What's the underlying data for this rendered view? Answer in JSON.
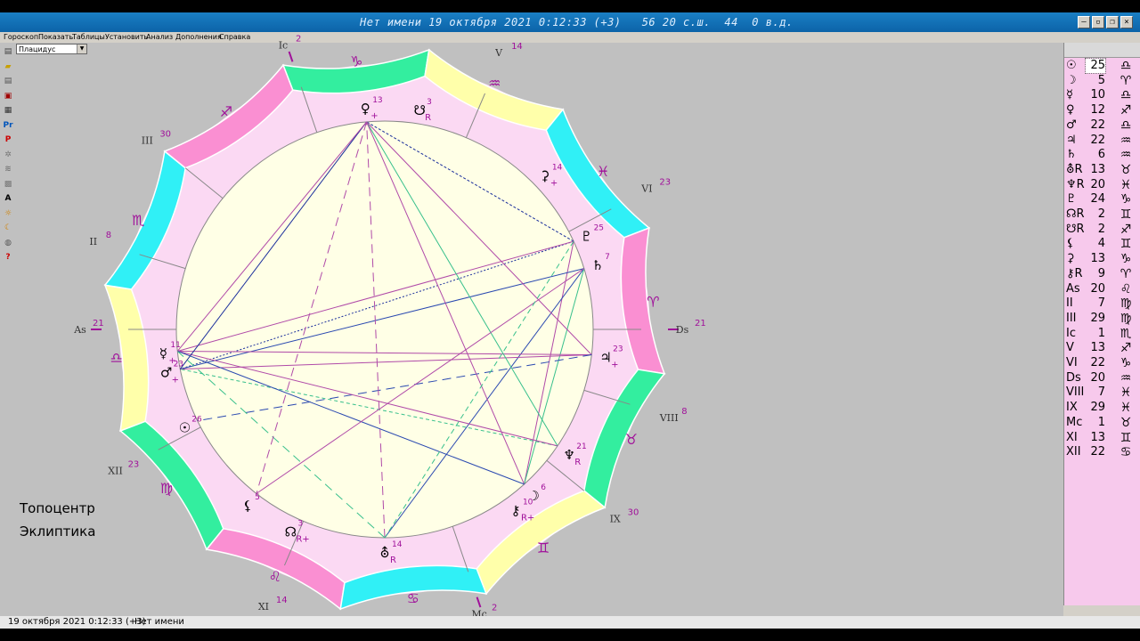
{
  "window": {
    "title": "Нет имени 19 октября 2021 0:12:33 (+3)   56 20 с.ш.  44  0 в.д."
  },
  "menu": [
    "Гороскоп",
    "Показать",
    "Таблицы",
    "Установить",
    "Анализ",
    "Дополнения",
    "Справка"
  ],
  "house_system": "Плацидус",
  "toolbar_icons": [
    {
      "name": "new-chart-icon",
      "glyph": "▤",
      "color": "#444"
    },
    {
      "name": "open-folder-icon",
      "glyph": "▰",
      "color": "#c8a000"
    },
    {
      "name": "document-icon",
      "glyph": "▤",
      "color": "#555"
    },
    {
      "name": "print-icon",
      "glyph": "▣",
      "color": "#a00000"
    },
    {
      "name": "copy-icon",
      "glyph": "▦",
      "color": "#333"
    },
    {
      "name": "pr-icon",
      "glyph": "Pr",
      "color": "#0055bb"
    },
    {
      "name": "p-icon",
      "glyph": "P",
      "color": "#cc0000"
    },
    {
      "name": "star-icon",
      "glyph": "✲",
      "color": "#777"
    },
    {
      "name": "lines-icon",
      "glyph": "≋",
      "color": "#777"
    },
    {
      "name": "grid-icon",
      "glyph": "▩",
      "color": "#777"
    },
    {
      "name": "font-icon",
      "glyph": "A",
      "color": "#000"
    },
    {
      "name": "sun-icon",
      "glyph": "☼",
      "color": "#d08000"
    },
    {
      "name": "moon-icon",
      "glyph": "☾",
      "color": "#d08000"
    },
    {
      "name": "globe-icon",
      "glyph": "◍",
      "color": "#555"
    },
    {
      "name": "help-icon",
      "glyph": "?",
      "color": "#cc0000"
    }
  ],
  "chart": {
    "asc_degree": 201,
    "zodiac_signs": [
      {
        "glyph": "♌",
        "color": "#fa8fd2"
      },
      {
        "glyph": "♍",
        "color": "#33ee9f"
      },
      {
        "glyph": "♎",
        "color": "#ffffaa"
      },
      {
        "glyph": "♏",
        "color": "#30f0f6"
      },
      {
        "glyph": "♐",
        "color": "#fa8fd2"
      },
      {
        "glyph": "♑",
        "color": "#33ee9f"
      },
      {
        "glyph": "♒",
        "color": "#ffffaa"
      },
      {
        "glyph": "♓",
        "color": "#30f0f6"
      },
      {
        "glyph": "♈",
        "color": "#fa8fd2"
      },
      {
        "glyph": "♉",
        "color": "#33ee9f"
      },
      {
        "glyph": "♊",
        "color": "#ffffaa"
      },
      {
        "glyph": "♋",
        "color": "#30f0f6"
      }
    ],
    "houses": [
      {
        "label": "As",
        "deg": "21",
        "lon": 201
      },
      {
        "label": "II",
        "deg": "8",
        "lon": 218
      },
      {
        "label": "III",
        "deg": "30",
        "lon": 240
      },
      {
        "label": "Ic",
        "deg": "2",
        "lon": 272
      },
      {
        "label": "V",
        "deg": "14",
        "lon": 314
      },
      {
        "label": "VI",
        "deg": "23",
        "lon": 353
      },
      {
        "label": "Ds",
        "deg": "21",
        "lon": 21
      },
      {
        "label": "VIII",
        "deg": "8",
        "lon": 38
      },
      {
        "label": "IX",
        "deg": "30",
        "lon": 60
      },
      {
        "label": "Mc",
        "deg": "2",
        "lon": 92
      },
      {
        "label": "XI",
        "deg": "14",
        "lon": 134
      },
      {
        "label": "XII",
        "deg": "23",
        "lon": 173
      }
    ],
    "planets": [
      {
        "name": "sun",
        "glyph": "☉",
        "deg": "26",
        "lon": 175,
        "flag": ""
      },
      {
        "name": "moon",
        "glyph": "☽",
        "deg": "6",
        "lon": 69,
        "flag": ""
      },
      {
        "name": "mercury",
        "glyph": "☿",
        "deg": "11",
        "lon": 195,
        "flag": "+"
      },
      {
        "name": "venus",
        "glyph": "♀",
        "deg": "13",
        "lon": 286,
        "flag": "+"
      },
      {
        "name": "mars",
        "glyph": "♂",
        "deg": "23",
        "lon": 190,
        "flag": "+"
      },
      {
        "name": "jupiter",
        "glyph": "♃",
        "deg": "23",
        "lon": 28,
        "flag": "+"
      },
      {
        "name": "saturn",
        "glyph": "♄",
        "deg": "7",
        "lon": 4,
        "flag": ""
      },
      {
        "name": "chiron",
        "glyph": "⚷",
        "deg": "10",
        "lon": 75,
        "flag": "R+"
      },
      {
        "name": "neptune",
        "glyph": "♆",
        "deg": "21",
        "lon": 55,
        "flag": "R"
      },
      {
        "name": "pluto",
        "glyph": "♇",
        "deg": "25",
        "lon": 356,
        "flag": ""
      },
      {
        "name": "node-north",
        "glyph": "☊",
        "deg": "3",
        "lon": 136,
        "flag": "R+"
      },
      {
        "name": "node-south",
        "glyph": "☋",
        "deg": "3",
        "lon": 300,
        "flag": "R"
      },
      {
        "name": "lilith",
        "glyph": "⚸",
        "deg": "5",
        "lon": 149,
        "flag": ""
      },
      {
        "name": "selena",
        "glyph": "⚳",
        "deg": "14",
        "lon": 337,
        "flag": "+"
      },
      {
        "name": "uranus",
        "glyph": "⛢",
        "deg": "14",
        "lon": 111,
        "flag": "R"
      }
    ],
    "aspects": [
      {
        "a": "pluto",
        "b": "venus",
        "color": "#1b2f9c",
        "dash": "3,2"
      },
      {
        "a": "pluto",
        "b": "mars",
        "color": "#1b2f9c",
        "dash": "2,2"
      },
      {
        "a": "pluto",
        "b": "mercury",
        "color": "#b04aa8",
        "dash": ""
      },
      {
        "a": "pluto",
        "b": "moon",
        "color": "#b04aa8",
        "dash": ""
      },
      {
        "a": "saturn",
        "b": "mars",
        "color": "#2a49b0",
        "dash": ""
      },
      {
        "a": "saturn",
        "b": "uranus",
        "color": "#2a49b0",
        "dash": ""
      },
      {
        "a": "saturn",
        "b": "moon",
        "color": "#38c08c",
        "dash": ""
      },
      {
        "a": "jupiter",
        "b": "mars",
        "color": "#b04aa8",
        "dash": ""
      },
      {
        "a": "jupiter",
        "b": "mercury",
        "color": "#b04aa8",
        "dash": ""
      },
      {
        "a": "jupiter",
        "b": "venus",
        "color": "#b04aa8",
        "dash": ""
      },
      {
        "a": "jupiter",
        "b": "sun",
        "color": "#2a49b0",
        "dash": "10,6"
      },
      {
        "a": "neptune",
        "b": "venus",
        "color": "#38c08c",
        "dash": ""
      },
      {
        "a": "neptune",
        "b": "mars",
        "color": "#38c08c",
        "dash": "4,3"
      },
      {
        "a": "neptune",
        "b": "mercury",
        "color": "#b04aa8",
        "dash": ""
      },
      {
        "a": "moon",
        "b": "venus",
        "color": "#b04aa8",
        "dash": ""
      },
      {
        "a": "moon",
        "b": "mercury",
        "color": "#2a49b0",
        "dash": ""
      },
      {
        "a": "uranus",
        "b": "venus",
        "color": "#b04aa8",
        "dash": "10,6"
      },
      {
        "a": "uranus",
        "b": "mercury",
        "color": "#38c08c",
        "dash": "10,6"
      },
      {
        "a": "venus",
        "b": "mars",
        "color": "#1b2f9c",
        "dash": ""
      },
      {
        "a": "venus",
        "b": "mercury",
        "color": "#b04aa8",
        "dash": ""
      },
      {
        "a": "venus",
        "b": "lilith",
        "color": "#b04aa8",
        "dash": "10,6"
      },
      {
        "a": "saturn",
        "b": "lilith",
        "color": "#b04aa8",
        "dash": ""
      },
      {
        "a": "pluto",
        "b": "uranus",
        "color": "#38c08c",
        "dash": "6,4"
      }
    ]
  },
  "modes": {
    "topocentric": "Топоцентр",
    "ecliptic": "Эклиптика"
  },
  "positions": [
    {
      "glyph": "☉",
      "deg": "25",
      "sign": "♎",
      "sel": true
    },
    {
      "glyph": "☽",
      "deg": "5",
      "sign": "♈",
      "sel": false
    },
    {
      "glyph": "☿",
      "deg": "10",
      "sign": "♎",
      "sel": false
    },
    {
      "glyph": "♀",
      "deg": "12",
      "sign": "♐",
      "sel": false
    },
    {
      "glyph": "♂",
      "deg": "22",
      "sign": "♎",
      "sel": false
    },
    {
      "glyph": "♃",
      "deg": "22",
      "sign": "♒",
      "sel": false
    },
    {
      "glyph": "♄",
      "deg": "6",
      "sign": "♒",
      "sel": false
    },
    {
      "glyph": "⛢R",
      "deg": "13",
      "sign": "♉",
      "sel": false
    },
    {
      "glyph": "♆R",
      "deg": "20",
      "sign": "♓",
      "sel": false
    },
    {
      "glyph": "♇",
      "deg": "24",
      "sign": "♑",
      "sel": false
    },
    {
      "glyph": "☊R",
      "deg": "2",
      "sign": "♊",
      "sel": false
    },
    {
      "glyph": "☋R",
      "deg": "2",
      "sign": "♐",
      "sel": false
    },
    {
      "glyph": "⚸",
      "deg": "4",
      "sign": "♊",
      "sel": false
    },
    {
      "glyph": "⚳",
      "deg": "13",
      "sign": "♑",
      "sel": false
    },
    {
      "glyph": "⚷R",
      "deg": "9",
      "sign": "♈",
      "sel": false
    },
    {
      "glyph": "As",
      "deg": "20",
      "sign": "♌",
      "sel": false
    },
    {
      "glyph": "II",
      "deg": "7",
      "sign": "♍",
      "sel": false
    },
    {
      "glyph": "III",
      "deg": "29",
      "sign": "♍",
      "sel": false
    },
    {
      "glyph": "Ic",
      "deg": "1",
      "sign": "♏",
      "sel": false
    },
    {
      "glyph": "V",
      "deg": "13",
      "sign": "♐",
      "sel": false
    },
    {
      "glyph": "VI",
      "deg": "22",
      "sign": "♑",
      "sel": false
    },
    {
      "glyph": "Ds",
      "deg": "20",
      "sign": "♒",
      "sel": false
    },
    {
      "glyph": "VIII",
      "deg": "7",
      "sign": "♓",
      "sel": false
    },
    {
      "glyph": "IX",
      "deg": "29",
      "sign": "♓",
      "sel": false
    },
    {
      "glyph": "Mc",
      "deg": "1",
      "sign": "♉",
      "sel": false
    },
    {
      "glyph": "XI",
      "deg": "13",
      "sign": "♊",
      "sel": false
    },
    {
      "glyph": "XII",
      "deg": "22",
      "sign": "♋",
      "sel": false
    }
  ],
  "status": {
    "datetime": "19 октября 2021  0:12:33 (+3)",
    "name": "Нет имени"
  }
}
